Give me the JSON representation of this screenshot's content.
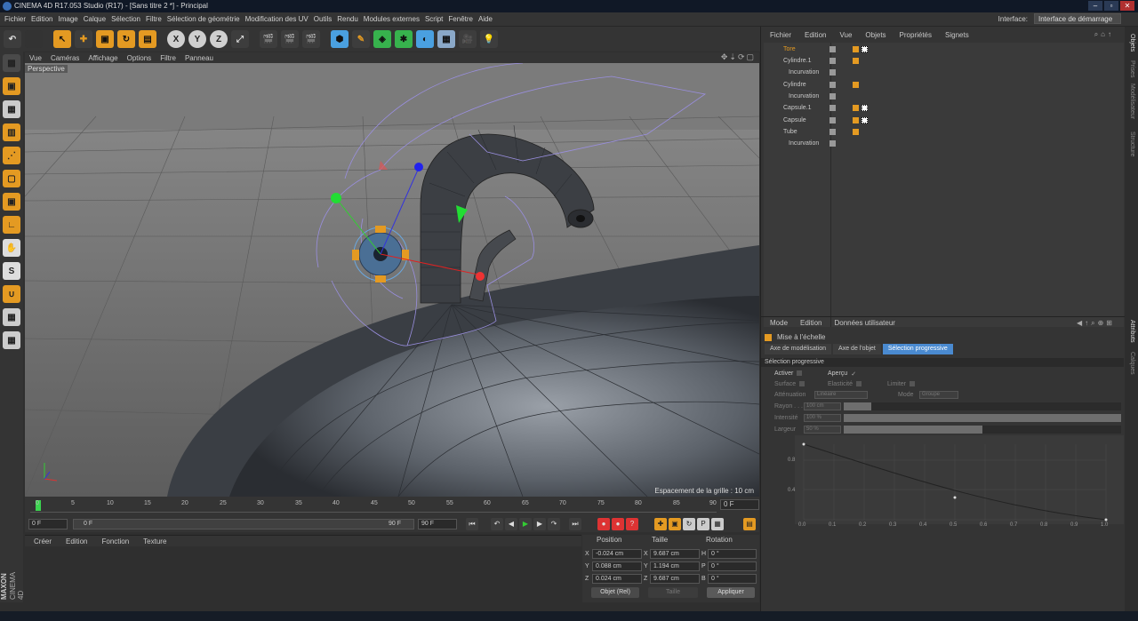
{
  "window": {
    "title": "CINEMA 4D R17.053 Studio (R17) - [Sans titre 2 *] - Principal"
  },
  "menu": [
    "Fichier",
    "Edition",
    "Image",
    "Calque",
    "Sélection",
    "Filtre",
    "Sélection de géométrie",
    "Modification des UV",
    "Outils",
    "Rendu",
    "Modules externes",
    "Script",
    "Fenêtre",
    "Aide"
  ],
  "interface": {
    "label": "Interface:",
    "value": "Interface de démarrage"
  },
  "viewport": {
    "menu": [
      "Vue",
      "Caméras",
      "Affichage",
      "Options",
      "Filtre",
      "Panneau"
    ],
    "label": "Perspective",
    "grid_spacing": "Espacement de la grille : 10 cm"
  },
  "timeline": {
    "ticks": [
      "0",
      "5",
      "10",
      "15",
      "20",
      "25",
      "30",
      "35",
      "40",
      "45",
      "50",
      "55",
      "60",
      "65",
      "70",
      "75",
      "80",
      "85",
      "90"
    ],
    "current_frame": "0 F",
    "start": "0 F",
    "preview_start": "0 F",
    "preview_end": "90 F",
    "end": "90 F"
  },
  "material": {
    "menu": [
      "Créer",
      "Edition",
      "Fonction",
      "Texture"
    ]
  },
  "brand": {
    "line1": "MAXON",
    "line2": "CINEMA 4D"
  },
  "coords": {
    "headers": {
      "position": "Position",
      "size": "Taille",
      "rotation": "Rotation"
    },
    "rows": [
      {
        "axis": "X",
        "pos": "-0.024 cm",
        "saxis": "X",
        "size": "9.687 cm",
        "raxis": "H",
        "rot": "0 °"
      },
      {
        "axis": "Y",
        "pos": "0.088 cm",
        "saxis": "Y",
        "size": "1.194 cm",
        "raxis": "P",
        "rot": "0 °"
      },
      {
        "axis": "Z",
        "pos": "0.024 cm",
        "saxis": "Z",
        "size": "9.687 cm",
        "raxis": "B",
        "rot": "0 °"
      }
    ],
    "mode": "Objet (Rel)",
    "size_mode": "Taille",
    "apply": "Appliquer"
  },
  "objects": {
    "menu": [
      "Fichier",
      "Edition",
      "Vue",
      "Objets",
      "Propriétés",
      "Signets"
    ],
    "items": [
      {
        "name": "Tore",
        "indent": 0,
        "selected": true
      },
      {
        "name": "Cylindre.1",
        "indent": 0,
        "selected": false
      },
      {
        "name": "Incurvation",
        "indent": 1,
        "selected": false
      },
      {
        "name": "Cylindre",
        "indent": 0,
        "selected": false
      },
      {
        "name": "Incurvation",
        "indent": 1,
        "selected": false
      },
      {
        "name": "Capsule.1",
        "indent": 0,
        "selected": false
      },
      {
        "name": "Capsule",
        "indent": 0,
        "selected": false
      },
      {
        "name": "Tube",
        "indent": 0,
        "selected": false
      },
      {
        "name": "Incurvation",
        "indent": 1,
        "selected": false
      }
    ]
  },
  "attributes": {
    "menu": [
      "Mode",
      "Edition",
      "Données utilisateur"
    ],
    "title": "Mise à l'échelle",
    "tabs": [
      "Axe de modélisation",
      "Axe de l'objet",
      "Sélection progressive"
    ],
    "section": "Sélection progressive",
    "activer": "Activer",
    "apercu": "Aperçu",
    "surface": "Surface",
    "elasticite": "Elasticité",
    "limiter": "Limiter",
    "attenuation_label": "Atténuation",
    "attenuation_value": "Linéaire",
    "mode_label": "Mode",
    "mode_value": "Groupe",
    "rayon_label": "Rayon . . .",
    "rayon_value": "100 cm",
    "intensite_label": "Intensité",
    "intensite_value": "100 %",
    "largeur_label": "Largeur",
    "largeur_value": "50 %",
    "graph_y": [
      "0.8",
      "0.4"
    ],
    "graph_x": [
      "0.0",
      "0.1",
      "0.2",
      "0.3",
      "0.4",
      "0.5",
      "0.6",
      "0.7",
      "0.8",
      "0.9",
      "1.0"
    ]
  },
  "side_tabs": [
    "Objets",
    "Prises",
    "Modélisateur",
    "Structure",
    "Attributs",
    "Calques"
  ]
}
